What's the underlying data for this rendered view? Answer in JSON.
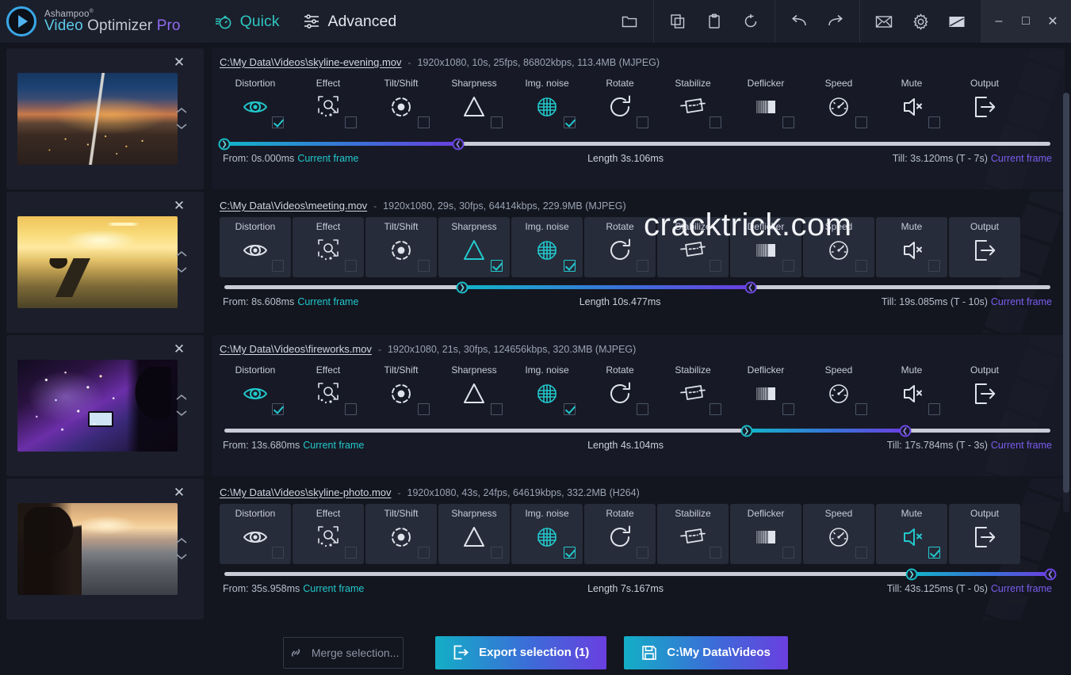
{
  "app": {
    "brand_top": "Ashampoo",
    "brand_sup": "®",
    "brand_w1": "Video",
    "brand_w2": " Optimizer ",
    "brand_w3": "Pro",
    "logo_icon": "play-circle-icon",
    "accent_teal": "#22c8cc",
    "accent_purple": "#6a3fe0"
  },
  "modes": [
    {
      "label": "Quick",
      "icon": "quick-stopwatch-icon",
      "active": true
    },
    {
      "label": "Advanced",
      "icon": "sliders-icon",
      "active": false
    }
  ],
  "toolbar": {
    "groups": [
      {
        "items": [
          {
            "name": "open-folder-icon",
            "title": "Open folder"
          }
        ]
      },
      {
        "items": [
          {
            "name": "copy-icon",
            "title": "Copy"
          },
          {
            "name": "paste-clipboard-icon",
            "title": "Paste"
          },
          {
            "name": "reset-icon",
            "title": "Reset"
          }
        ]
      },
      {
        "items": [
          {
            "name": "undo-icon",
            "title": "Undo"
          },
          {
            "name": "redo-icon",
            "title": "Redo"
          }
        ]
      },
      {
        "items": [
          {
            "name": "mail-icon",
            "title": "Mail"
          },
          {
            "name": "gear-icon",
            "title": "Settings"
          },
          {
            "name": "theme-icon",
            "title": "Theme"
          }
        ]
      }
    ],
    "window_controls": [
      {
        "name": "minimize-icon",
        "glyph": "–"
      },
      {
        "name": "maximize-icon",
        "glyph": "□"
      },
      {
        "name": "close-icon",
        "glyph": "✕"
      }
    ]
  },
  "tool_columns": [
    "Distortion",
    "Effect",
    "Tilt/Shift",
    "Sharpness",
    "Img. noise",
    "Rotate",
    "Stabilize",
    "Deflicker",
    "Speed",
    "Mute",
    "Output"
  ],
  "tool_icons": [
    "distortion-eye-icon",
    "effect-icon",
    "tilt-shift-icon",
    "sharpness-triangle-icon",
    "img-noise-grid-icon",
    "rotate-icon",
    "stabilize-icon",
    "deflicker-icon",
    "speed-gauge-icon",
    "mute-icon",
    "output-export-icon"
  ],
  "rows": [
    {
      "thumbnail": "city-skyline-evening",
      "path": "C:\\My Data\\Videos\\skyline-evening.mov",
      "dash": "-",
      "meta": "1920x1080, 10s, 25fps, 86802kbps, 113.4MB (MJPEG)",
      "style": "dark",
      "checks": [
        true,
        false,
        false,
        false,
        true,
        false,
        false,
        false,
        false,
        false
      ],
      "from_label": "From: 0s.000ms",
      "from_link": "Current frame",
      "length_label": "Length  3s.106ms",
      "till_label": "Till: 3s.120ms (T - 7s)",
      "till_link": "Current frame",
      "sel_start_pct": 0,
      "sel_end_pct": 28.3
    },
    {
      "thumbnail": "sunset-laptop",
      "path": "C:\\My Data\\Videos\\meeting.mov",
      "dash": "-",
      "meta": "1920x1080, 29s, 30fps, 64414kbps, 229.9MB (MJPEG)",
      "style": "plain",
      "checks": [
        false,
        false,
        false,
        true,
        true,
        false,
        false,
        false,
        false,
        false
      ],
      "from_label": "From: 8s.608ms",
      "from_link": "Current frame",
      "length_label": "Length  10s.477ms",
      "till_label": "Till: 19s.085ms (T - 10s)",
      "till_link": "Current frame",
      "sel_start_pct": 28.8,
      "sel_end_pct": 63.7
    },
    {
      "thumbnail": "fireworks-phone",
      "path": "C:\\My Data\\Videos\\fireworks.mov",
      "dash": "-",
      "meta": "1920x1080, 21s, 30fps, 124656kbps, 320.3MB (MJPEG)",
      "style": "dark",
      "checks": [
        true,
        false,
        false,
        false,
        true,
        false,
        false,
        false,
        false,
        false
      ],
      "from_label": "From: 13s.680ms",
      "from_link": "Current frame",
      "length_label": "Length  4s.104ms",
      "till_label": "Till: 17s.784ms (T - 3s)",
      "till_link": "Current frame",
      "sel_start_pct": 63.2,
      "sel_end_pct": 82.4
    },
    {
      "thumbnail": "woman-city-sunrise",
      "path": "C:\\My Data\\Videos\\skyline-photo.mov",
      "dash": "-",
      "meta": "1920x1080, 43s, 24fps, 64619kbps, 332.2MB (H264)",
      "style": "plain",
      "checks": [
        false,
        false,
        false,
        false,
        true,
        false,
        false,
        false,
        false,
        true
      ],
      "from_label": "From: 35s.958ms",
      "from_link": "Current frame",
      "length_label": "Length  7s.167ms",
      "till_label": "Till: 43s.125ms (T - 0s)",
      "till_link": "Current frame",
      "sel_start_pct": 83.2,
      "sel_end_pct": 100
    }
  ],
  "row_controls": {
    "close_icon": "close-icon",
    "up_icon": "chevron-up-icon",
    "down_icon": "chevron-down-icon"
  },
  "watermark": "cracktrick.com",
  "footer": {
    "merge_label": "Merge selection...",
    "merge_icon": "link-chain-icon",
    "export_label": "Export selection (1)",
    "export_icon": "export-icon",
    "output_path_label": "C:\\My Data\\Videos",
    "output_path_icon": "save-disk-icon"
  }
}
